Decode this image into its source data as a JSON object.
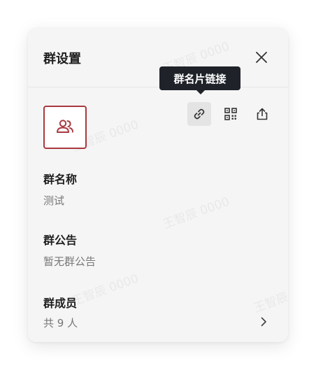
{
  "header": {
    "title": "群设置"
  },
  "tooltip": {
    "text": "群名片链接"
  },
  "watermark": {
    "text": "王智辰 0000"
  },
  "group_name": {
    "label": "群名称",
    "value": "测试"
  },
  "announcement": {
    "label": "群公告",
    "value": "暂无群公告"
  },
  "members": {
    "label": "群成员",
    "value": "共 9 人"
  },
  "icons": {
    "close": "close-icon",
    "link": "link-icon",
    "qrcode": "qrcode-icon",
    "share": "share-icon",
    "group": "group-icon",
    "chevron": "chevron-right-icon"
  },
  "colors": {
    "accent": "#a8393f",
    "tooltip_bg": "#1f2329",
    "panel_bg": "#f5f5f5"
  }
}
